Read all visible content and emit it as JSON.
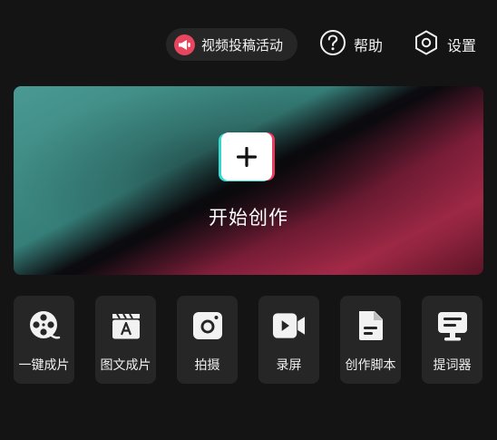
{
  "header": {
    "promo_label": "视频投稿活动",
    "help_label": "帮助",
    "settings_label": "设置"
  },
  "create_card": {
    "label": "开始创作"
  },
  "tools": [
    {
      "label": "一键成片",
      "icon": "film-reel-icon"
    },
    {
      "label": "图文成片",
      "icon": "clapper-text-icon"
    },
    {
      "label": "拍摄",
      "icon": "camera-icon"
    },
    {
      "label": "录屏",
      "icon": "screen-record-icon"
    },
    {
      "label": "创作脚本",
      "icon": "script-document-icon"
    },
    {
      "label": "提词器",
      "icon": "teleprompter-icon"
    }
  ],
  "colors": {
    "background": "#141414",
    "tile": "#262626",
    "accent_red": "#e8455f",
    "accent_cyan": "#38d8d0",
    "gradient_teal": "#4a9a93",
    "gradient_crimson": "#a22947"
  }
}
